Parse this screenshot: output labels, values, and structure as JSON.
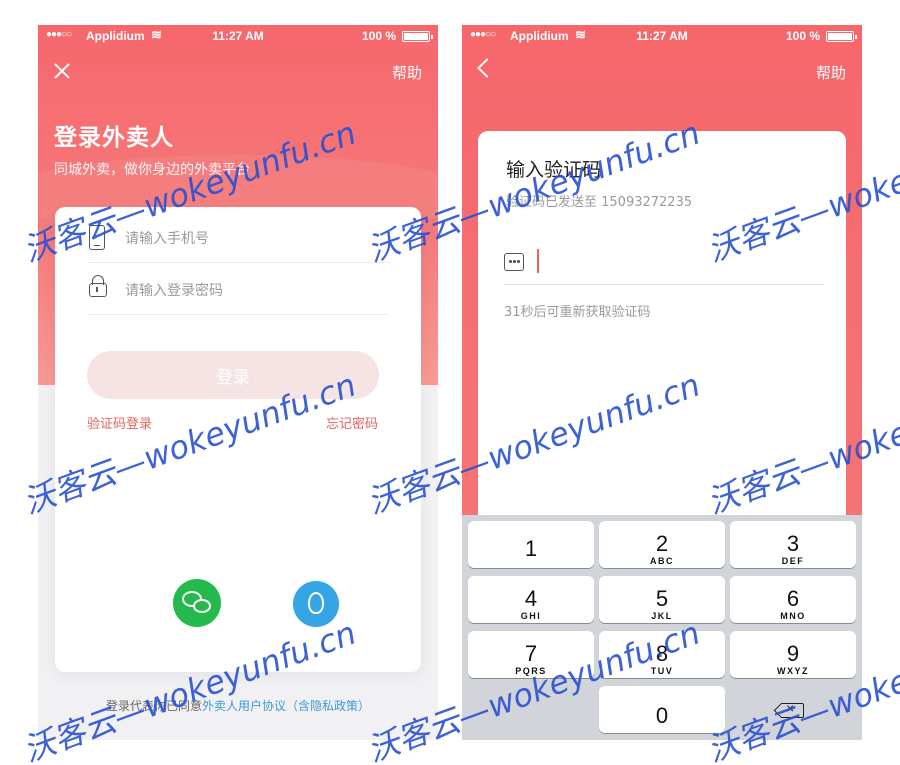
{
  "status_bar": {
    "dots": "●●●○○",
    "carrier": "Applidium",
    "time": "11:27 AM",
    "battery": "100 %",
    "battery_level": 1.0
  },
  "login_screen": {
    "help": "帮助",
    "title": "登录外卖人",
    "subtitle": "同城外卖，做你身边的外卖平台",
    "phone_placeholder": "请输入手机号",
    "password_placeholder": "请输入登录密码",
    "login_button": "登录",
    "code_login_link": "验证码登录",
    "forgot_password_link": "忘记密码",
    "agreement_prefix": "登录代表你已同意",
    "agreement_link": "外卖人用户协议（含隐私政策）"
  },
  "code_screen": {
    "help": "帮助",
    "title": "输入验证码",
    "sent_text": "验证码已发送至 15093272235",
    "countdown": "31秒后可重新获取验证码"
  },
  "keyboard": {
    "keys": [
      {
        "digit": "1",
        "letters": ""
      },
      {
        "digit": "2",
        "letters": "ABC"
      },
      {
        "digit": "3",
        "letters": "DEF"
      },
      {
        "digit": "4",
        "letters": "GHI"
      },
      {
        "digit": "5",
        "letters": "JKL"
      },
      {
        "digit": "6",
        "letters": "MNO"
      },
      {
        "digit": "7",
        "letters": "PQRS"
      },
      {
        "digit": "8",
        "letters": "TUV"
      },
      {
        "digit": "9",
        "letters": "WXYZ"
      },
      {
        "digit": "0",
        "letters": ""
      }
    ]
  },
  "watermark": "沃客云—wokeyunfu.cn",
  "colors": {
    "brand_red": "#f6676c",
    "link_red": "#e8625f",
    "link_blue": "#3e9ad6",
    "wechat_green": "#23b94d",
    "qq_blue": "#36a5e6"
  }
}
